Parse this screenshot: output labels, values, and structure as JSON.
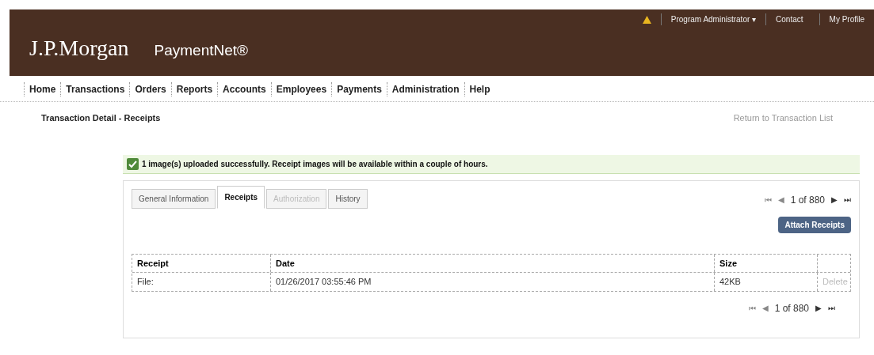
{
  "header": {
    "logo": "J.P.Morgan",
    "product": "PaymentNet®",
    "user_menu": "Program Administrator ▾",
    "links": [
      "Contact",
      "My Profile"
    ]
  },
  "nav": [
    {
      "label": "Home",
      "disabled": false
    },
    {
      "label": "Transactions",
      "disabled": false
    },
    {
      "label": "Orders",
      "disabled": false
    },
    {
      "label": "Reports",
      "disabled": false
    },
    {
      "label": "Accounts",
      "disabled": false
    },
    {
      "label": "Employees",
      "disabled": false
    },
    {
      "label": "Payments",
      "disabled": false
    },
    {
      "label": "Administration",
      "disabled": false
    },
    {
      "label": "Help",
      "disabled": false
    }
  ],
  "breadcrumb": "Transaction Detail - Receipts",
  "return_link": "Return to Transaction List",
  "message": "1 image(s) uploaded successfully. Receipt images will be available within a couple of hours.",
  "tabs": [
    {
      "label": "General Information",
      "selected": false,
      "disabled": false
    },
    {
      "label": "Receipts",
      "selected": true,
      "disabled": false
    },
    {
      "label": "Authorization",
      "selected": false,
      "disabled": true
    },
    {
      "label": "History",
      "selected": false,
      "disabled": false
    }
  ],
  "pager_top": {
    "first": "⏮",
    "prev": "◀",
    "text": "1 of 880",
    "next": "▶",
    "last": "⏭"
  },
  "attach_button": "Attach Receipts",
  "table": {
    "columns": [
      "Receipt",
      "Date",
      "Size"
    ],
    "rows": [
      {
        "cells": [
          "File:",
          "01/26/2017 03:55:46 PM",
          "42KB"
        ],
        "action": "Delete"
      }
    ]
  },
  "pager_bottom": {
    "first": "⏮",
    "prev": "◀",
    "text": "1 of 880",
    "next": "▶",
    "last": "⏭"
  }
}
